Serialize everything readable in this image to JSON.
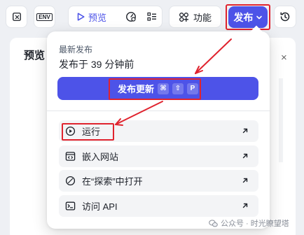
{
  "toolbar": {
    "preview_label": "预览",
    "features_label": "功能",
    "publish_label": "发布",
    "env_label": "ENV"
  },
  "background_panel": {
    "title": "预览",
    "close_glyph": "×"
  },
  "dropdown": {
    "latest_label": "最新发布",
    "published_time": "发布于 39 分钟前",
    "update_button": {
      "label": "发布更新",
      "shortcut": [
        "⌘",
        "⇧",
        "P"
      ]
    },
    "items": [
      {
        "label": "运行",
        "icon": "play-circle-icon"
      },
      {
        "label": "嵌入网站",
        "icon": "embed-window-icon"
      },
      {
        "label": "在“探索”中打开",
        "icon": "compass-icon"
      },
      {
        "label": "访问 API",
        "icon": "terminal-icon"
      }
    ]
  },
  "watermark": "公众号 · 时光瞭望塔",
  "colors": {
    "accent": "#4d53e8",
    "annotation_red": "#e0232e",
    "background": "#eef0f4"
  }
}
